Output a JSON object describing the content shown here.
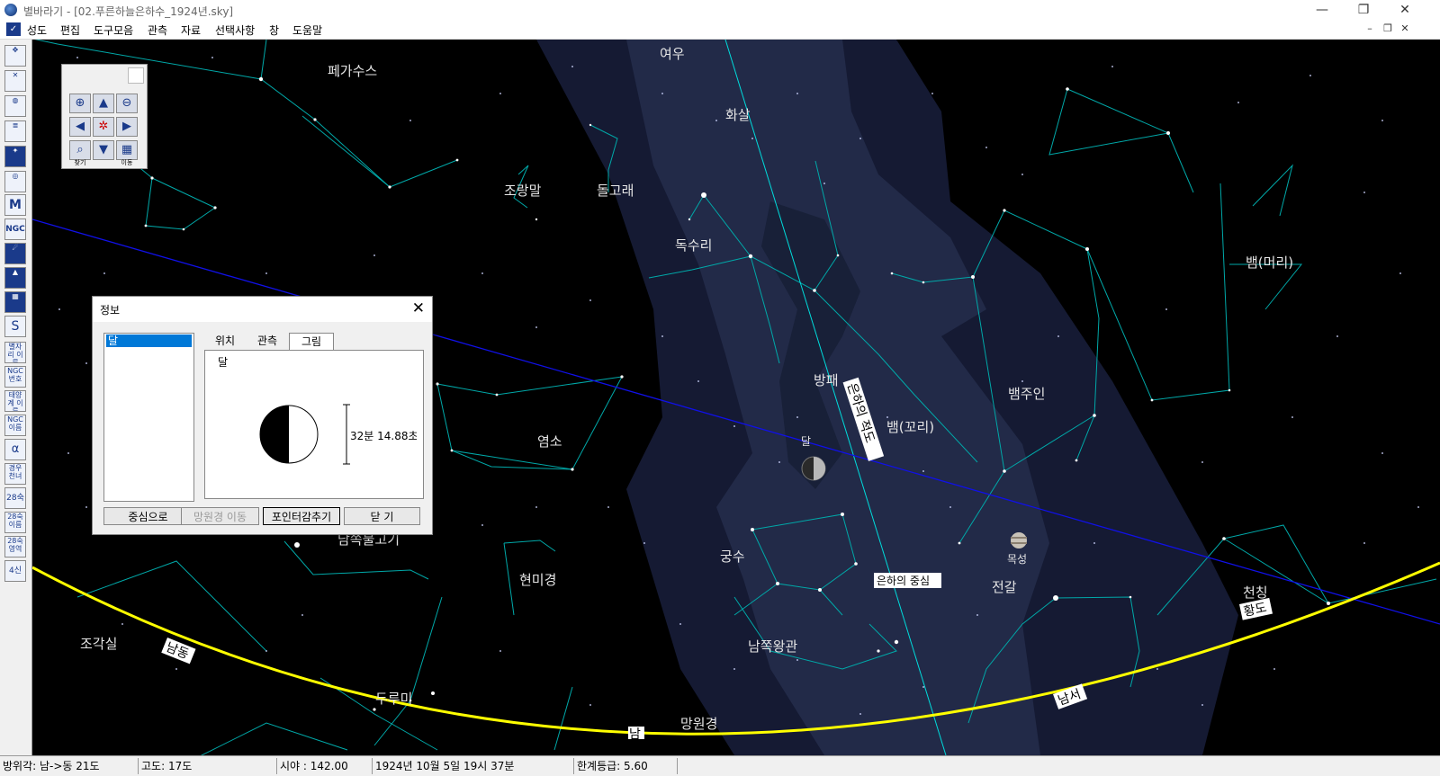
{
  "window": {
    "title": "별바라기 - [02.푸른하늘은하수_1924년.sky]",
    "minimize": "—",
    "restore": "❐",
    "close": "✕"
  },
  "menu": {
    "items": [
      "성도",
      "편집",
      "도구모음",
      "관측",
      "자료",
      "선택사항",
      "창",
      "도움말"
    ],
    "mdi_minimize": "–",
    "mdi_restore": "❐",
    "mdi_close": "✕"
  },
  "toolbar": {
    "buttons": [
      "",
      "",
      "",
      "",
      "",
      "",
      "M",
      "NGC",
      "",
      "",
      "",
      "",
      "별자리 이름",
      "NGC 번호",
      "태양계 이름",
      "NGC 이름",
      "α",
      "경우 천녀",
      "28숙",
      "28숙 이름",
      "28숙 영역",
      "4신"
    ]
  },
  "nav_panel": {
    "zoom_in": "⊕",
    "up": "▲",
    "zoom_out": "⊖",
    "left": "◀",
    "center": "✲",
    "right": "▶",
    "find_label": "찾기",
    "down": "▼",
    "move_label": "이동"
  },
  "sky_labels": {
    "constellations": [
      "페가수스",
      "여우",
      "화살",
      "조랑말",
      "돌고래",
      "독수리",
      "뱀(머리)",
      "방패",
      "뱀주인",
      "뱀(꼬리)",
      "염소",
      "남쪽물고기",
      "궁수",
      "현미경",
      "전갈",
      "천칭",
      "조각실",
      "남쪽왕관",
      "두루미",
      "망원경"
    ],
    "moon": "달",
    "jupiter": "목성",
    "galactic_equator": "은하의 적도",
    "galactic_center": "은하의 중심",
    "ecliptic": "황도",
    "horizon_se": "남동",
    "horizon_s": "남",
    "horizon_sw": "남서"
  },
  "colors": {
    "horizon": "#ffff00",
    "ecliptic": "#0000ff",
    "galactic_equator": "#00ffff",
    "constellation_lines": "#00b0b0",
    "milky_way": "#1a2040"
  },
  "info_dialog": {
    "title": "정보",
    "close": "✕",
    "list_items": [
      "달"
    ],
    "tabs": [
      "위치",
      "관측",
      "그림"
    ],
    "active_tab": "그림",
    "object_name": "달",
    "apparent_size": "32분 14.88초",
    "buttons": {
      "center": "중심으로",
      "telescope_move": "망원경 이동",
      "hide_pointer": "포인터감추기",
      "close": "닫      기"
    }
  },
  "status": {
    "azimuth": "방위각: 남->동  21도",
    "altitude": "고도:   17도",
    "fov": "시야 : 142.00",
    "datetime": "1924년 10월  5일 19시 37분",
    "limit_mag": "한계등급:   5.60"
  }
}
